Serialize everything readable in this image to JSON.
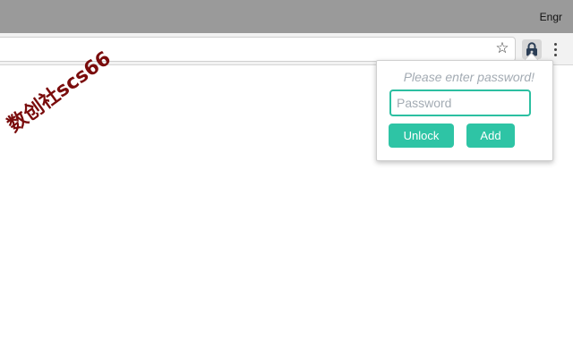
{
  "browser": {
    "profile_name": "Engr",
    "icons": {
      "bookmark": "star-icon",
      "extension": "lock-icon",
      "menu": "vertical-dots-icon"
    }
  },
  "watermark": {
    "text": "数创社scs66"
  },
  "popup": {
    "prompt": "Please enter password!",
    "password_placeholder": "Password",
    "password_value": "",
    "unlock_label": "Unlock",
    "add_label": "Add"
  },
  "colors": {
    "accent": "#2ec4a5",
    "input_border": "#2cbfa1",
    "titlebar": "#9a9a9a",
    "watermark": "#7a0c0c"
  }
}
